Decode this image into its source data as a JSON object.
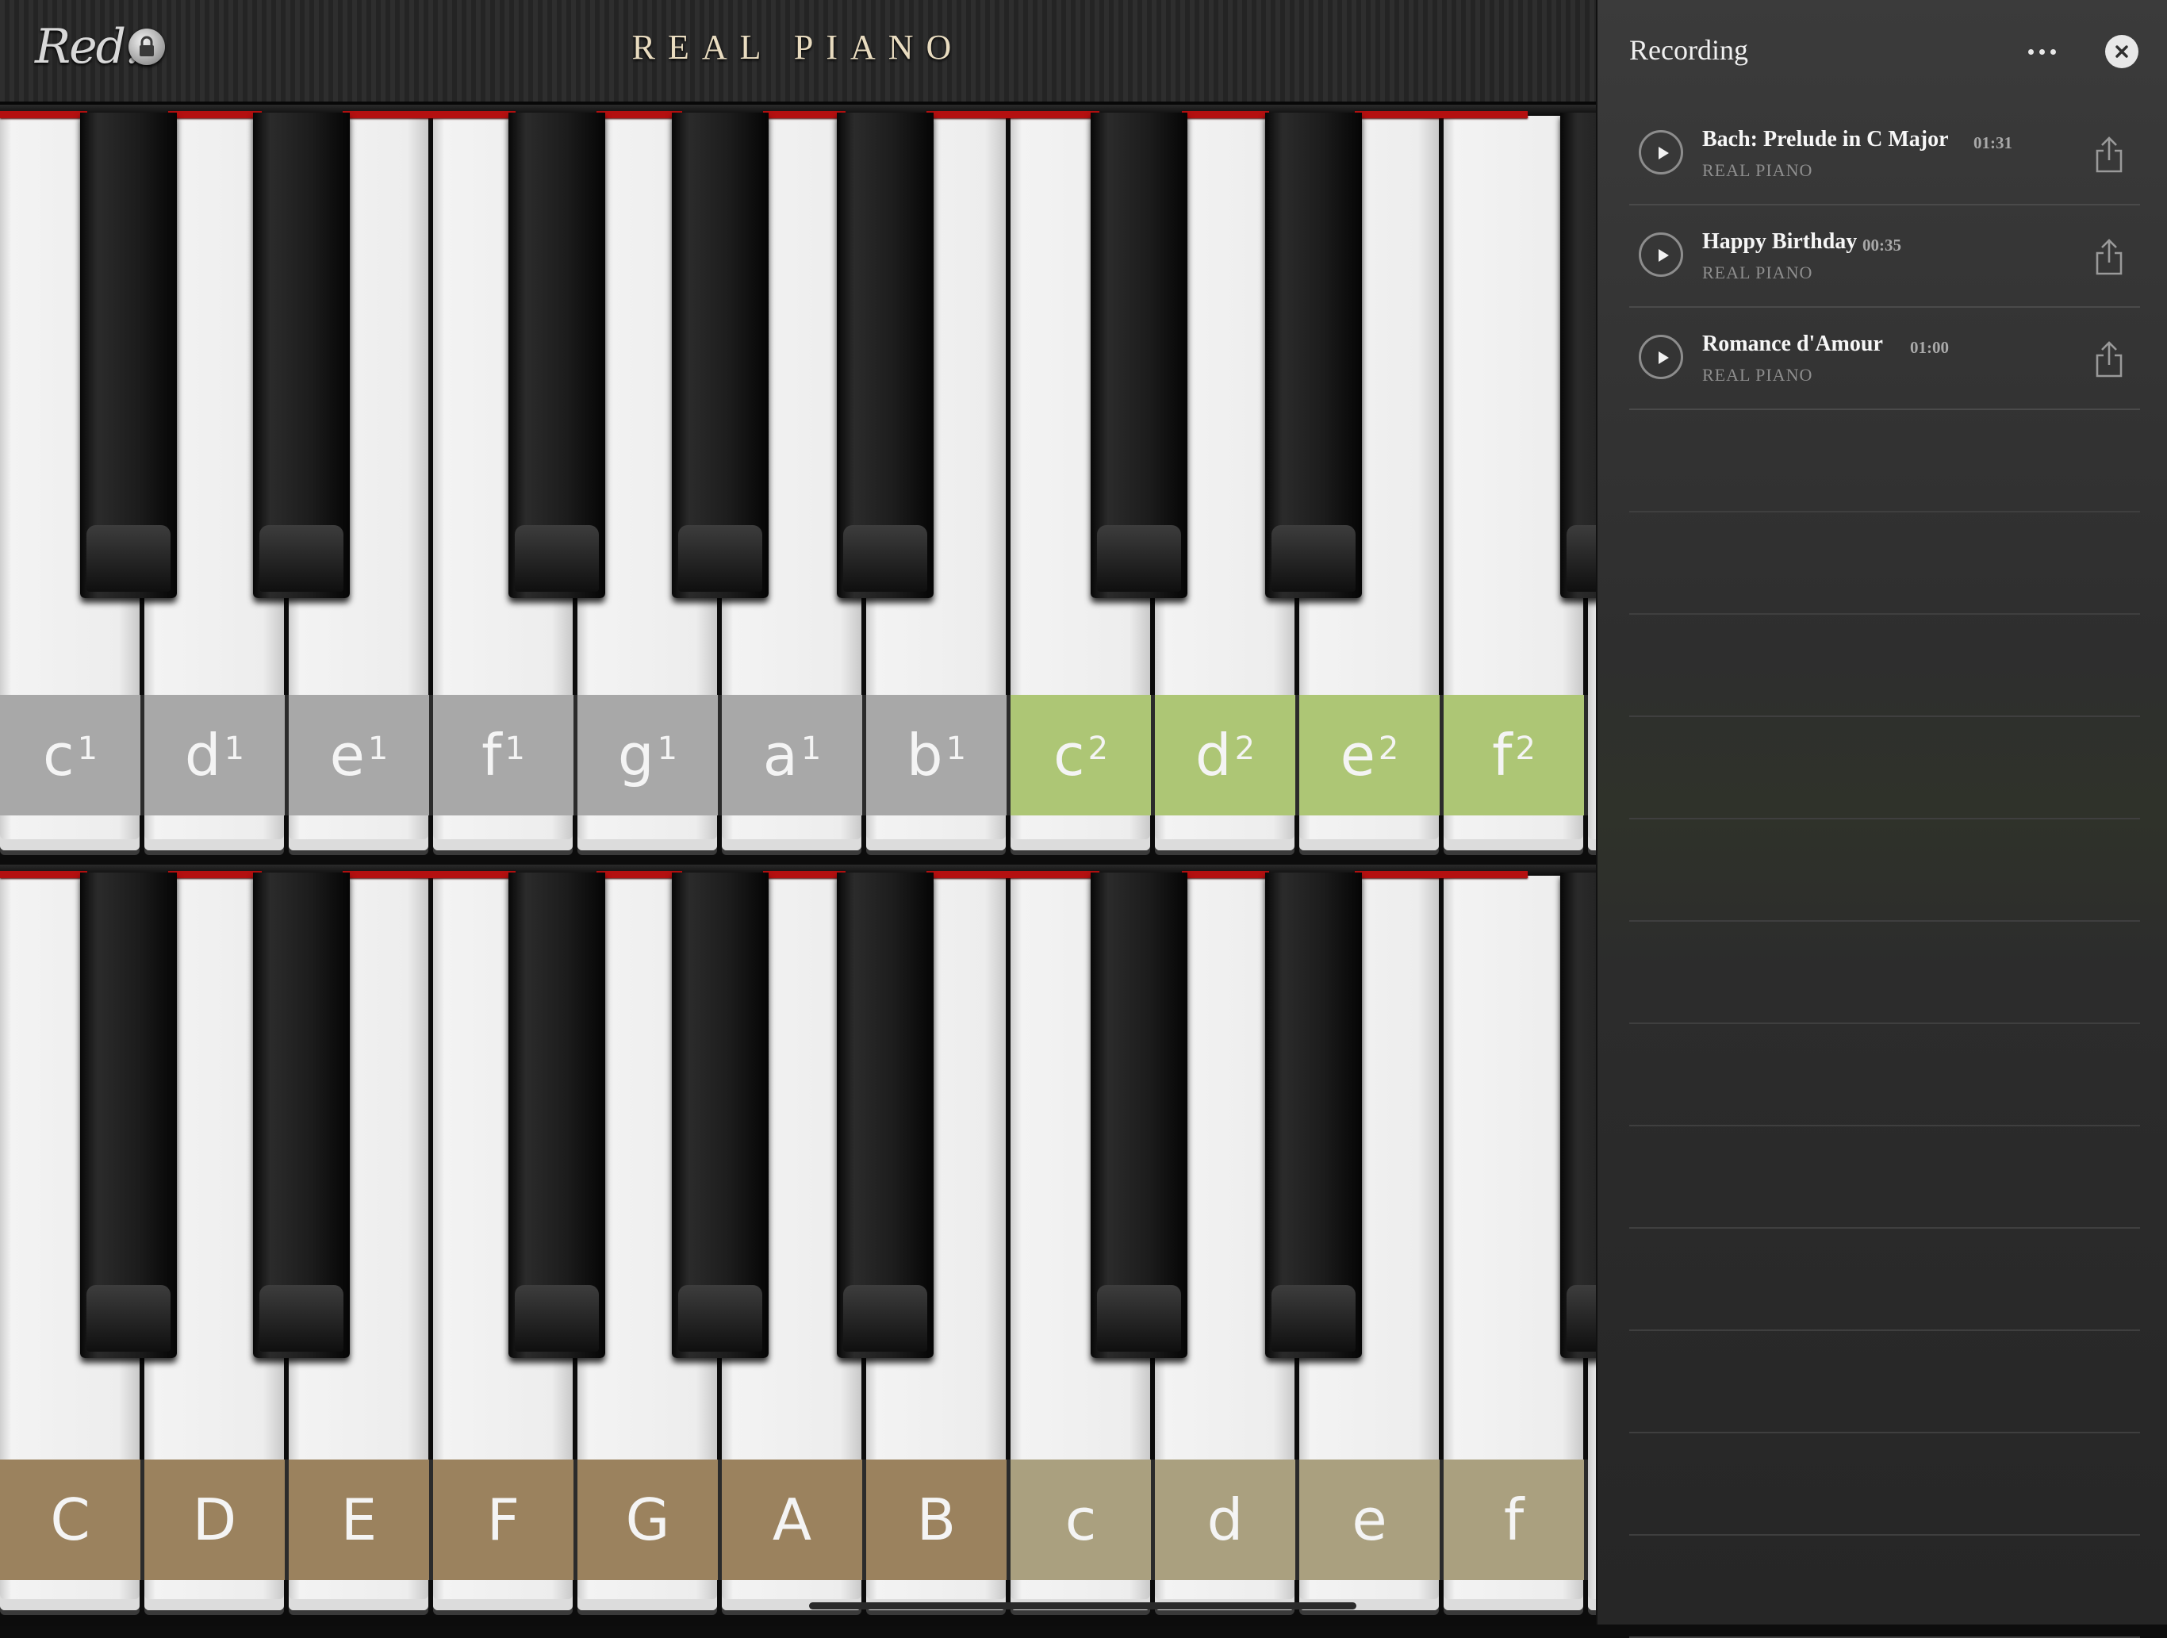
{
  "header": {
    "logo": "Red.",
    "title": "REAL PIANO"
  },
  "keyboards": {
    "top": {
      "labels": [
        {
          "note": "c",
          "octave": "1",
          "color": "#a8a8a8"
        },
        {
          "note": "d",
          "octave": "1",
          "color": "#a8a8a8"
        },
        {
          "note": "e",
          "octave": "1",
          "color": "#a8a8a8"
        },
        {
          "note": "f",
          "octave": "1",
          "color": "#a8a8a8"
        },
        {
          "note": "g",
          "octave": "1",
          "color": "#a8a8a8"
        },
        {
          "note": "a",
          "octave": "1",
          "color": "#a8a8a8"
        },
        {
          "note": "b",
          "octave": "1",
          "color": "#a8a8a8"
        },
        {
          "note": "c",
          "octave": "2",
          "color": "#adc675"
        },
        {
          "note": "d",
          "octave": "2",
          "color": "#adc675"
        },
        {
          "note": "e",
          "octave": "2",
          "color": "#adc675"
        },
        {
          "note": "f",
          "octave": "2",
          "color": "#adc675"
        }
      ]
    },
    "bottom": {
      "labels": [
        {
          "note": "C",
          "octave": "",
          "color": "#9b825e"
        },
        {
          "note": "D",
          "octave": "",
          "color": "#9b825e"
        },
        {
          "note": "E",
          "octave": "",
          "color": "#9b825e"
        },
        {
          "note": "F",
          "octave": "",
          "color": "#9b825e"
        },
        {
          "note": "G",
          "octave": "",
          "color": "#9b825e"
        },
        {
          "note": "A",
          "octave": "",
          "color": "#9b825e"
        },
        {
          "note": "B",
          "octave": "",
          "color": "#9b825e"
        },
        {
          "note": "c",
          "octave": "",
          "color": "#aaa07f"
        },
        {
          "note": "d",
          "octave": "",
          "color": "#aaa07f"
        },
        {
          "note": "e",
          "octave": "",
          "color": "#aaa07f"
        },
        {
          "note": "f",
          "octave": "",
          "color": "#aaa07f"
        }
      ]
    }
  },
  "panel": {
    "title": "Recording",
    "recordings": [
      {
        "title": "Bach: Prelude in C Major",
        "duration": "01:31",
        "source": "REAL PIANO"
      },
      {
        "title": "Happy Birthday",
        "duration": "00:35",
        "source": "REAL PIANO"
      },
      {
        "title": "Romance d'Amour",
        "duration": "01:00",
        "source": "REAL PIANO"
      }
    ]
  },
  "icons": {
    "lock": "lock-icon",
    "more": "more-icon",
    "close": "close-icon",
    "play": "play-icon",
    "share": "share-icon"
  },
  "colors": {
    "felt": "#b41010",
    "grey_band": "#a8a8a8",
    "green_band": "#adc675",
    "brown_band": "#9b825e",
    "olive_band": "#aaa07f"
  }
}
